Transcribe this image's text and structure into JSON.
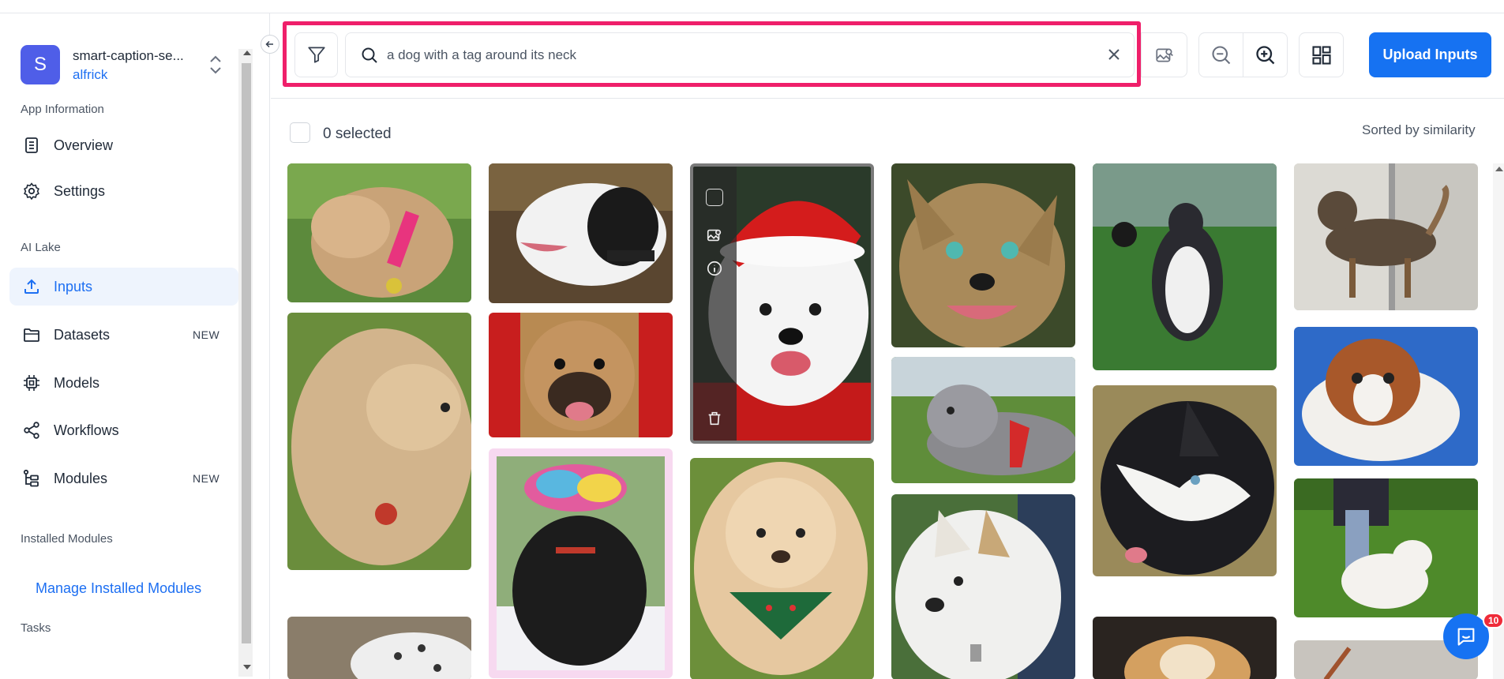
{
  "sidebar": {
    "app": {
      "avatar_letter": "S",
      "name": "smart-caption-se...",
      "user": "alfrick"
    },
    "sections": {
      "app_info": "App Information",
      "ai_lake": "AI Lake",
      "installed": "Installed Modules",
      "tasks": "Tasks"
    },
    "items": [
      {
        "label": "Overview",
        "icon": "document-icon"
      },
      {
        "label": "Settings",
        "icon": "gear-icon"
      },
      {
        "label": "Inputs",
        "icon": "upload-icon",
        "active": true
      },
      {
        "label": "Datasets",
        "icon": "folder-icon",
        "badge": "NEW"
      },
      {
        "label": "Models",
        "icon": "chip-icon"
      },
      {
        "label": "Workflows",
        "icon": "share-icon"
      },
      {
        "label": "Modules",
        "icon": "modules-icon",
        "badge": "NEW"
      }
    ],
    "manage_link": "Manage Installed Modules"
  },
  "toolbar": {
    "search_value": "a dog with a tag around its neck",
    "upload_label": "Upload Inputs"
  },
  "selection": {
    "count_text": "0 selected"
  },
  "sort_text": "Sorted by similarity",
  "gallery": {
    "images": [
      {
        "name": "beagle mix with pink collar"
      },
      {
        "name": "black and white dog with collar"
      },
      {
        "name": "white dog in santa hat",
        "hovered": true
      },
      {
        "name": "tan dog with glowing eyes"
      },
      {
        "name": "husky sitting on grass"
      },
      {
        "name": "merle dog in doorway"
      },
      {
        "name": "fluffy terrier mix"
      },
      {
        "name": "boxer against red background"
      },
      {
        "name": "grey dog lying on grass with red harness"
      },
      {
        "name": "husky close up"
      },
      {
        "name": "spaniel on blue blanket"
      },
      {
        "name": "black puppy in colorful hat"
      },
      {
        "name": "golden dog with bandana"
      },
      {
        "name": "white dog with tag"
      },
      {
        "name": "white dog on grass"
      },
      {
        "name": "dalmatian"
      },
      {
        "name": "tan dog"
      },
      {
        "name": "dog partial"
      }
    ]
  },
  "chat": {
    "badge_count": "10"
  },
  "colors": {
    "accent": "#1672f2",
    "highlight": "#ef1f6a",
    "badge": "#ef2b39"
  }
}
